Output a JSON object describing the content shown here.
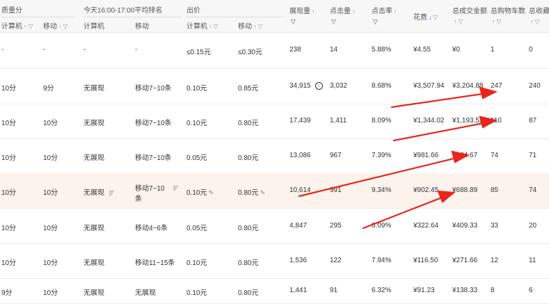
{
  "header": {
    "group_quality": "质量分",
    "group_rank": "今天16:00-17:00平均排名",
    "group_bid": "出价",
    "sub_computer": "计算机",
    "sub_mobile": "移动",
    "impressions": "展现量",
    "clicks": "点击量",
    "ctr": "点击率",
    "cost": "花费",
    "gmv": "总成交金额",
    "carts": "总购物车数",
    "favorites": "总收藏",
    "sort_up": "↑",
    "sort_down": "↓",
    "filter": "▽"
  },
  "rows": [
    {
      "q_pc": "-",
      "q_m": "-",
      "r_pc": "-",
      "r_m": "-",
      "b_pc": "≤0.15元",
      "b_m": "≤0.30元",
      "imp": "238",
      "clk": "14",
      "ctr": "5.88%",
      "cost": "¥4.55",
      "gmv": "¥0",
      "cart": "1",
      "fav": "0"
    },
    {
      "q_pc": "10分",
      "q_m": "9分",
      "r_pc": "无展现",
      "r_m": "移动7~10条",
      "b_pc": "0.10元",
      "b_m": "0.85元",
      "imp": "34,915",
      "clk": "3,032",
      "ctr": "8.68%",
      "cost": "¥3,507.94",
      "gmv": "¥3,204.88",
      "cart": "247",
      "fav": "240"
    },
    {
      "q_pc": "10分",
      "q_m": "10分",
      "r_pc": "无展现",
      "r_m": "移动7~10条",
      "b_pc": "0.10元",
      "b_m": "0.80元",
      "imp": "17,439",
      "clk": "1,411",
      "ctr": "8.09%",
      "cost": "¥1,344.02",
      "gmv": "¥1,193.53",
      "cart": "110",
      "fav": "87"
    },
    {
      "q_pc": "10分",
      "q_m": "10分",
      "r_pc": "无展现",
      "r_m": "移动7~10条",
      "b_pc": "0.05元",
      "b_m": "0.80元",
      "imp": "13,086",
      "clk": "967",
      "ctr": "7.39%",
      "cost": "¥981.66",
      "gmv": "¥564.67",
      "cart": "74",
      "fav": "71"
    },
    {
      "q_pc": "10分",
      "q_m": "10分",
      "r_pc": "无展现",
      "r_m": "移动7~10",
      "r_m2": "条",
      "b_pc": "0.10元",
      "b_m": "0.80元",
      "imp": "10,614",
      "clk": "991",
      "ctr": "9.34%",
      "cost": "¥902.45",
      "gmv": "¥688.89",
      "cart": "85",
      "fav": "74"
    },
    {
      "q_pc": "10分",
      "q_m": "10分",
      "r_pc": "无展现",
      "r_m": "移动4~6条",
      "b_pc": "0.05元",
      "b_m": "0.80元",
      "imp": "4,847",
      "clk": "295",
      "ctr": "6.09%",
      "cost": "¥322.64",
      "gmv": "¥409.33",
      "cart": "33",
      "fav": "20"
    },
    {
      "q_pc": "10分",
      "q_m": "10分",
      "r_pc": "无展现",
      "r_m": "移动11~15条",
      "b_pc": "0.10元",
      "b_m": "0.80元",
      "imp": "1,536",
      "clk": "122",
      "ctr": "7.94%",
      "cost": "¥116.50",
      "gmv": "¥271.66",
      "cart": "12",
      "fav": "11"
    },
    {
      "q_pc": "9分",
      "q_m": "10分",
      "r_pc": "无展现",
      "r_m": "无展现",
      "b_pc": "0.10元",
      "b_m": "0.80元",
      "imp": "1,441",
      "clk": "91",
      "ctr": "6.32%",
      "cost": "¥91.23",
      "gmv": "¥138.33",
      "cart": "8",
      "fav": "6"
    }
  ],
  "icons": {
    "download": "download-icon",
    "bars": "bars-icon",
    "edit": "edit-pencil-icon"
  },
  "colors": {
    "arrow": "#e8261c",
    "highlight_row": "#fbf3ec",
    "sort_active": "#1a73e8"
  }
}
